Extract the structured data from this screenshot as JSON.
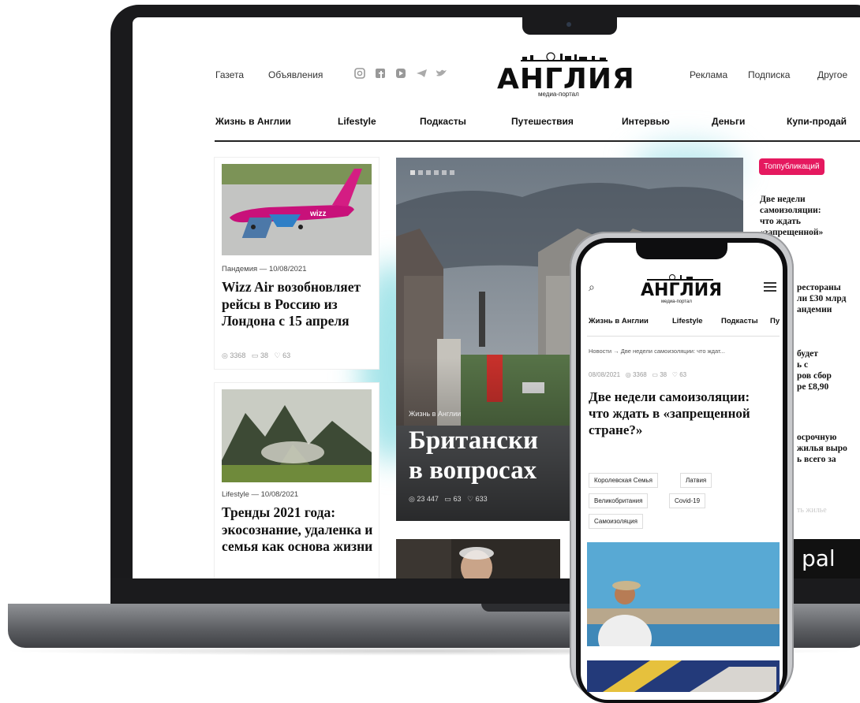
{
  "site": {
    "logo": "АНГЛИЯ",
    "logo_subtitle": "медиа-портал"
  },
  "header": {
    "left_links": [
      "Газета",
      "Объявления"
    ],
    "right_links": [
      "Реклама",
      "Подписка",
      "Другое"
    ]
  },
  "social_icons": [
    "instagram-icon",
    "facebook-icon",
    "youtube-icon",
    "telegram-icon",
    "twitter-icon"
  ],
  "nav": [
    "Жизнь в Англии",
    "Lifestyle",
    "Подкасты",
    "Путешествия",
    "Интервью",
    "Деньги",
    "Купи-продай"
  ],
  "cards": [
    {
      "meta": "Пандемия — 10/08/2021",
      "title": "Wizz Air возобновляет рейсы в Россию из Лондона с 15 апреля",
      "views": "3368",
      "comments": "38",
      "likes": "63"
    },
    {
      "meta": "Lifestyle — 10/08/2021",
      "title": "Тренды 2021 года: экосознание, удаленка и семья как основа жизни"
    }
  ],
  "hero": {
    "category": "Жизнь в Англии",
    "title_line1": "Британски",
    "title_line2": "в вопросах",
    "views": "23 447",
    "comments": "63",
    "likes": "633"
  },
  "sidebar": {
    "badge": "Топпубликаций",
    "item1_lines": [
      "Две недели",
      "самоизоляции:",
      "что ждать",
      "«запрещенной»",
      "?"
    ],
    "item2_lines": [
      "рестораны",
      "ли £30 млрд",
      "андемии"
    ],
    "item3_lines": [
      "будет",
      "ь с",
      "ров сбор",
      "ре £8,90"
    ],
    "item4_lines": [
      "осрочную",
      "жилья выро",
      "ь всего за"
    ],
    "faded": "ть жилье",
    "banner_text": "pal"
  },
  "phone": {
    "logo": "АНГЛИЯ",
    "logo_subtitle": "медиа-портал",
    "nav": [
      "Жизнь в Англии",
      "Lifestyle",
      "Подкасты",
      "Пу"
    ],
    "breadcrumb_home": "Новости",
    "breadcrumb_arrow": "→",
    "breadcrumb_current": "Две недели самоизоляции: что ждат...",
    "date": "08/08/2021",
    "views": "3368",
    "comments": "38",
    "likes": "63",
    "title": "Две недели самоизоляции: что ждать в «запрещенной стране?»",
    "tags": [
      "Королевская Семья",
      "Латвия",
      "Великобритания",
      "Covid-19",
      "Самоизоляция"
    ]
  }
}
